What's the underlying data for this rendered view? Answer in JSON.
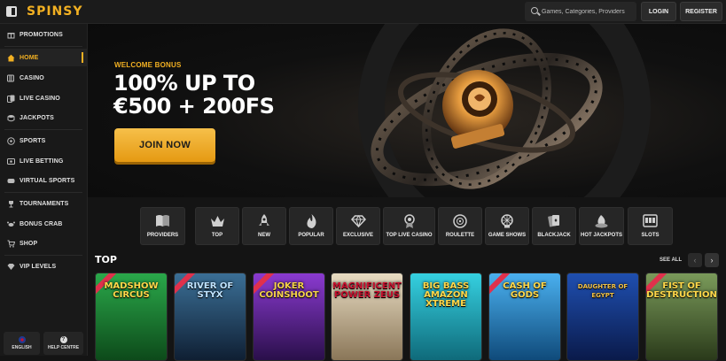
{
  "header": {
    "logo": "SPINSY",
    "search_placeholder": "Games, Categories, Providers",
    "login_label": "LOGIN",
    "register_label": "REGISTER"
  },
  "sidebar": {
    "items": [
      {
        "label": "PROMOTIONS",
        "icon": "gift-icon"
      },
      {
        "label": "HOME",
        "icon": "home-icon",
        "active": true
      },
      {
        "label": "CASINO",
        "icon": "slot-icon"
      },
      {
        "label": "LIVE CASINO",
        "icon": "cards-icon"
      },
      {
        "label": "JACKPOTS",
        "icon": "coins-icon"
      },
      {
        "label": "SPORTS",
        "icon": "ball-icon"
      },
      {
        "label": "LIVE BETTING",
        "icon": "live-icon"
      },
      {
        "label": "VIRTUAL SPORTS",
        "icon": "virtual-icon"
      },
      {
        "label": "TOURNAMENTS",
        "icon": "trophy-icon"
      },
      {
        "label": "BONUS CRAB",
        "icon": "crab-icon"
      },
      {
        "label": "SHOP",
        "icon": "cart-icon"
      },
      {
        "label": "VIP LEVELS",
        "icon": "diamond-icon"
      }
    ],
    "language_label": "ENGLISH",
    "help_label": "HELP CENTRE"
  },
  "hero": {
    "eyebrow": "WELCOME BONUS",
    "title_line1": "100% UP TO",
    "title_line2": "€500 + 200FS",
    "cta_label": "JOIN NOW"
  },
  "categories": [
    {
      "label": "PROVIDERS",
      "icon": "book-icon"
    },
    {
      "label": "TOP",
      "icon": "crown-icon"
    },
    {
      "label": "NEW",
      "icon": "rocket-icon"
    },
    {
      "label": "POPULAR",
      "icon": "flame-icon"
    },
    {
      "label": "EXCLUSIVE",
      "icon": "diamond-icon"
    },
    {
      "label": "TOP LIVE CASINO",
      "icon": "medal-icon"
    },
    {
      "label": "ROULETTE",
      "icon": "roulette-icon"
    },
    {
      "label": "GAME SHOWS",
      "icon": "gameshow-icon"
    },
    {
      "label": "BLACKJACK",
      "icon": "cards-icon"
    },
    {
      "label": "HOT JACKPOTS",
      "icon": "fire-icon"
    },
    {
      "label": "SLOTS",
      "icon": "slots-icon"
    }
  ],
  "top_section": {
    "title": "TOP",
    "see_all": "SEE ALL",
    "games": [
      {
        "title": "MADSHOW CIRCUS",
        "color": "#1d7a2c"
      },
      {
        "title": "RIVER OF STYX",
        "color": "#1e3c5a"
      },
      {
        "title": "JOKER COINSHOOT",
        "color": "#7a2fb0"
      },
      {
        "title": "MAGNIFICENT POWER ZEUS",
        "color": "#b8a88c"
      },
      {
        "title": "BIG BASS AMAZON XTREME",
        "color": "#19a7b8"
      },
      {
        "title": "CASH OF GODS",
        "color": "#2a8fcf"
      },
      {
        "title": "DAUGHTER OF EGYPT",
        "color": "#143a8a"
      },
      {
        "title": "FIST OF DESTRUCTION",
        "color": "#5a7a3a"
      }
    ]
  },
  "colors": {
    "accent": "#f2b022",
    "background": "#141414",
    "sidebar": "#191919"
  }
}
